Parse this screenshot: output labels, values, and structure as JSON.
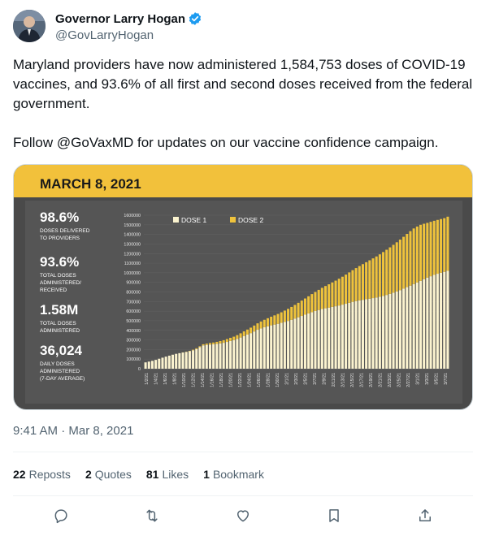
{
  "author": {
    "name": "Governor Larry Hogan",
    "handle": "@GovLarryHogan",
    "verified_icon": "verified-badge-icon"
  },
  "tweet": {
    "text": "Maryland providers have now administered 1,584,753 doses of COVID-19 vaccines, and 93.6% of all first and second doses received from the federal government.\n\nFollow @GoVaxMD for updates on our vaccine confidence campaign."
  },
  "infographic": {
    "date_title": "MARCH 8, 2021",
    "colors": {
      "banner": "#f2c13b",
      "background": "#4a4a4a",
      "dose1": "#fbf3cf",
      "dose2": "#efc33c",
      "text": "#ffffff"
    },
    "stats": [
      {
        "value": "98.6%",
        "label": "DOSES DELIVERED\nTO PROVIDERS"
      },
      {
        "value": "93.6%",
        "label": "TOTAL DOSES\nADMINISTERED/\nRECEIVED"
      },
      {
        "value": "1.58M",
        "label": "TOTAL DOSES\nADMINISTERED"
      },
      {
        "value": "36,024",
        "label": "DAILY DOSES\nADMINISTERED\n(7-DAY AVERAGE)"
      }
    ]
  },
  "chart_data": {
    "type": "bar",
    "stacked": true,
    "legend": [
      "DOSE 1",
      "DOSE 2"
    ],
    "legend_position": "top",
    "ylim": [
      0,
      1600000
    ],
    "yticks": [
      "1600000",
      "1500000",
      "1400000",
      "1300000",
      "1200000",
      "1100000",
      "1000000",
      "900000",
      "800000",
      "700000",
      "600000",
      "500000",
      "400000",
      "300000",
      "200000",
      "100000",
      "0"
    ],
    "xticks": [
      "1/2/21",
      "1/4/21",
      "1/6/21",
      "1/8/21",
      "1/10/21",
      "1/12/21",
      "1/14/21",
      "1/16/21",
      "1/18/21",
      "1/20/21",
      "1/22/21",
      "1/24/21",
      "1/26/21",
      "1/28/21",
      "1/30/21",
      "2/1/21",
      "2/3/21",
      "2/5/21",
      "2/7/21",
      "2/9/21",
      "2/11/21",
      "2/13/21",
      "2/15/21",
      "2/17/21",
      "2/19/21",
      "2/21/21",
      "2/23/21",
      "2/25/21",
      "2/27/21",
      "3/1/21",
      "3/3/21",
      "3/5/21",
      "3/7/21"
    ],
    "series": [
      {
        "name": "DOSE 1",
        "values": [
          66000,
          74000,
          82000,
          92000,
          104000,
          115000,
          126000,
          136000,
          146000,
          155000,
          162000,
          169000,
          175000,
          182000,
          192000,
          205000,
          224000,
          243000,
          248000,
          252000,
          255000,
          259000,
          264000,
          270000,
          279000,
          289000,
          298000,
          310000,
          325000,
          341000,
          356000,
          371000,
          388000,
          406000,
          420000,
          432000,
          442000,
          452000,
          460000,
          468000,
          478000,
          488000,
          498000,
          510000,
          523000,
          536000,
          550000,
          563000,
          576000,
          589000,
          601000,
          612000,
          622000,
          630000,
          637000,
          644000,
          651000,
          659000,
          668000,
          677000,
          687000,
          697000,
          705000,
          712000,
          718000,
          724000,
          730000,
          736000,
          742000,
          750000,
          759000,
          769000,
          780000,
          792000,
          805000,
          819000,
          834000,
          850000,
          866000,
          882000,
          899000,
          916000,
          933000,
          949000,
          964000,
          978000,
          990000,
          1000000,
          1010000,
          1020000
        ]
      },
      {
        "name": "DOSE 2",
        "values": [
          0,
          0,
          0,
          0,
          0,
          0,
          0,
          0,
          0,
          0,
          0,
          1000,
          2000,
          4000,
          6000,
          8000,
          10000,
          12000,
          14000,
          16000,
          18000,
          21000,
          24000,
          27000,
          30000,
          33000,
          36000,
          40000,
          44000,
          48000,
          52000,
          57000,
          62000,
          67000,
          72000,
          78000,
          84000,
          90000,
          96000,
          103000,
          110000,
          118000,
          126000,
          134000,
          142000,
          151000,
          160000,
          169000,
          179000,
          189000,
          199000,
          210000,
          221000,
          232000,
          243000,
          255000,
          267000,
          279000,
          291000,
          304000,
          317000,
          330000,
          344000,
          358000,
          372000,
          386000,
          400000,
          414000,
          428000,
          442000,
          457000,
          471000,
          485000,
          499000,
          513000,
          527000,
          541000,
          555000,
          568000,
          580000,
          583000,
          584000,
          578000,
          571000,
          567000,
          564000,
          561000,
          560000,
          559000,
          564753
        ]
      }
    ]
  },
  "timestamp": "9:41 AM · Mar 8, 2021",
  "engagement": [
    {
      "count": "22",
      "label": "Reposts"
    },
    {
      "count": "2",
      "label": "Quotes"
    },
    {
      "count": "81",
      "label": "Likes"
    },
    {
      "count": "1",
      "label": "Bookmark"
    }
  ],
  "actions": [
    "reply-icon",
    "retweet-icon",
    "like-icon",
    "bookmark-icon",
    "share-icon"
  ]
}
